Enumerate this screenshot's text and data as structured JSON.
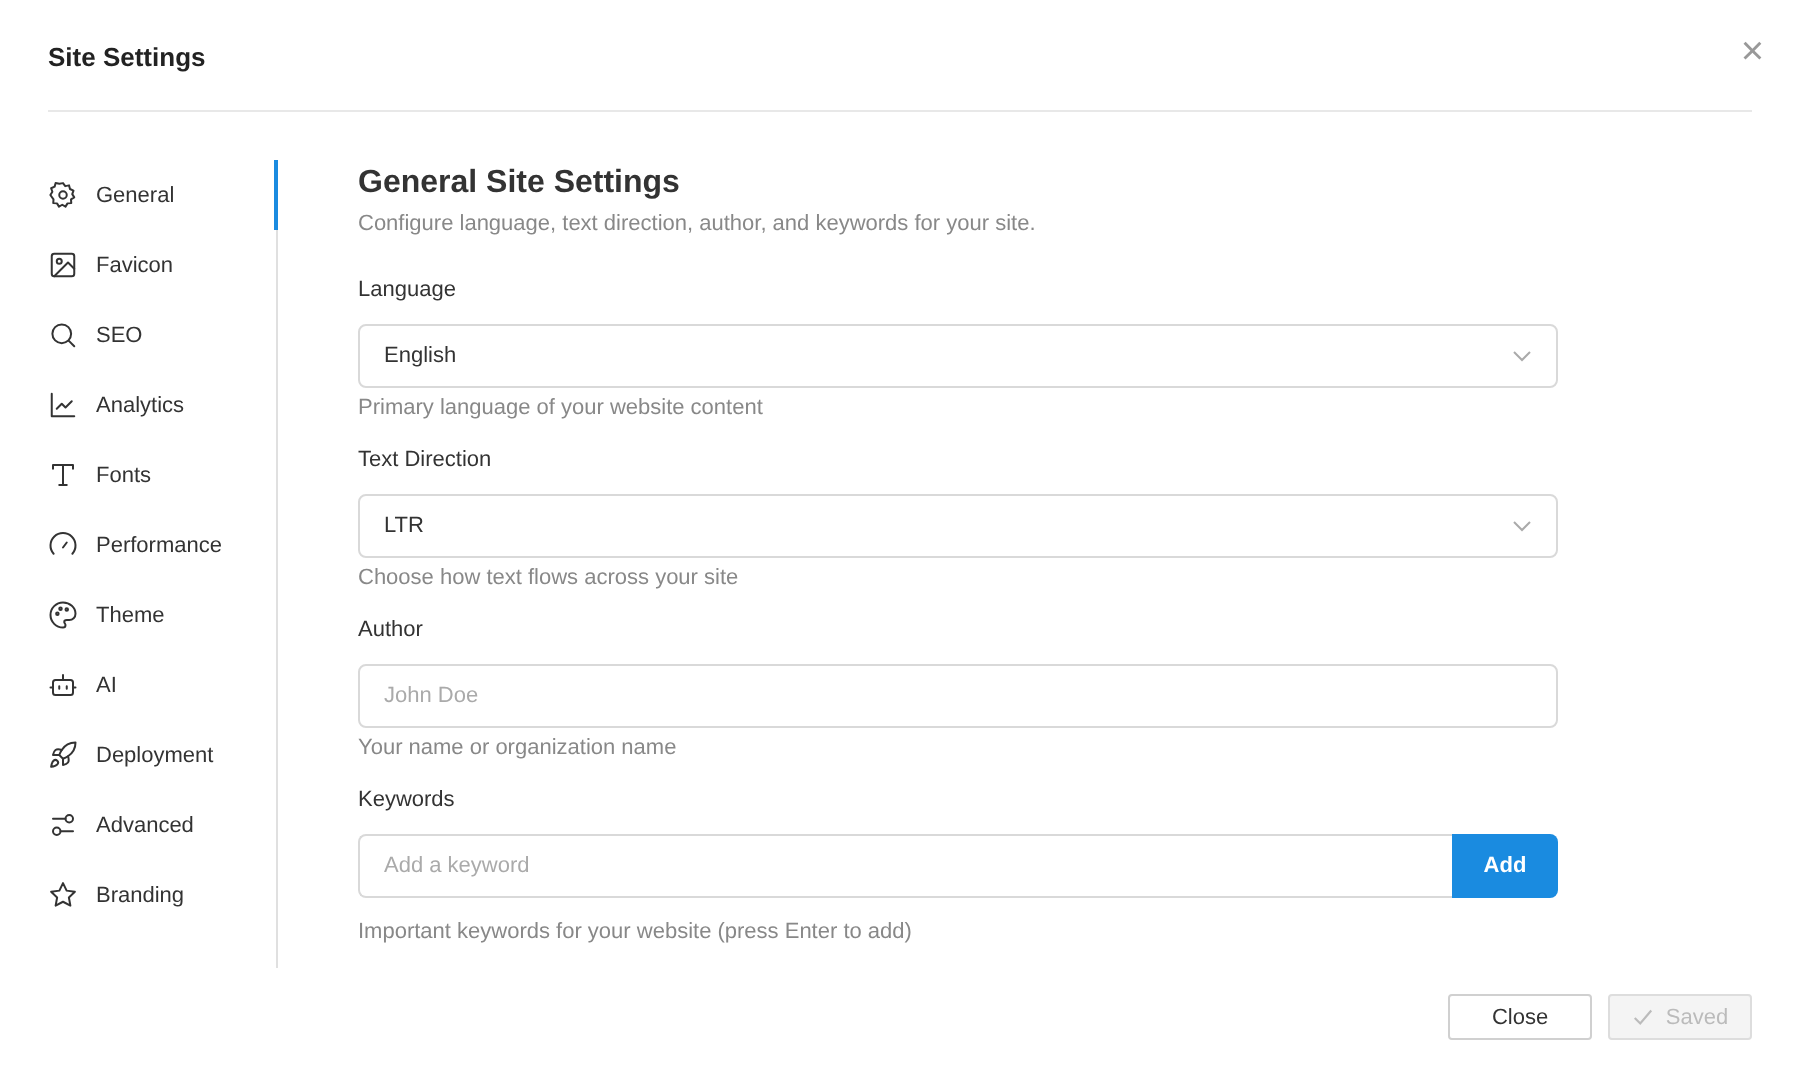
{
  "dialog": {
    "title": "Site Settings",
    "close_label": "×"
  },
  "sidebar": {
    "items": [
      {
        "label": "General",
        "selected": true
      },
      {
        "label": "Favicon",
        "selected": false
      },
      {
        "label": "SEO",
        "selected": false
      },
      {
        "label": "Analytics",
        "selected": false
      },
      {
        "label": "Fonts",
        "selected": false
      },
      {
        "label": "Performance",
        "selected": false
      },
      {
        "label": "Theme",
        "selected": false
      },
      {
        "label": "AI",
        "selected": false
      },
      {
        "label": "Deployment",
        "selected": false
      },
      {
        "label": "Advanced",
        "selected": false
      },
      {
        "label": "Branding",
        "selected": false
      }
    ]
  },
  "content": {
    "heading": "General Site Settings",
    "subtitle": "Configure language, text direction, author, and keywords for your site.",
    "fields": [
      {
        "kind": "select",
        "label": "Language",
        "value": "English",
        "help": "Primary language of your website content"
      },
      {
        "kind": "select",
        "label": "Text Direction",
        "value": "LTR",
        "help": "Choose how text flows across your site"
      },
      {
        "kind": "text",
        "label": "Author",
        "placeholder": "John Doe",
        "help": "Your name or organization name"
      },
      {
        "kind": "keyword",
        "label": "Keywords",
        "placeholder": "Add a keyword",
        "button": "Add",
        "help": "Important keywords for your website (press Enter to add)"
      }
    ]
  },
  "footer": {
    "buttons": [
      {
        "label": "Close",
        "disabled": false,
        "checked": false
      },
      {
        "label": "Saved",
        "disabled": true,
        "checked": true
      }
    ]
  }
}
